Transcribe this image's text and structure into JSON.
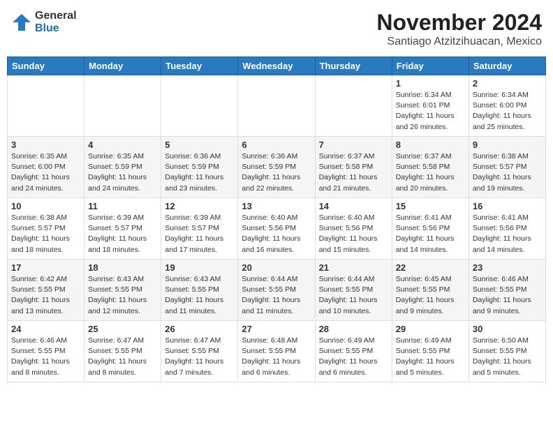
{
  "header": {
    "logo_general": "General",
    "logo_blue": "Blue",
    "month_title": "November 2024",
    "location": "Santiago Atzitzihuacan, Mexico"
  },
  "weekdays": [
    "Sunday",
    "Monday",
    "Tuesday",
    "Wednesday",
    "Thursday",
    "Friday",
    "Saturday"
  ],
  "weeks": [
    [
      {
        "day": "",
        "info": ""
      },
      {
        "day": "",
        "info": ""
      },
      {
        "day": "",
        "info": ""
      },
      {
        "day": "",
        "info": ""
      },
      {
        "day": "",
        "info": ""
      },
      {
        "day": "1",
        "info": "Sunrise: 6:34 AM\nSunset: 6:01 PM\nDaylight: 11 hours and 26 minutes."
      },
      {
        "day": "2",
        "info": "Sunrise: 6:34 AM\nSunset: 6:00 PM\nDaylight: 11 hours and 25 minutes."
      }
    ],
    [
      {
        "day": "3",
        "info": "Sunrise: 6:35 AM\nSunset: 6:00 PM\nDaylight: 11 hours and 24 minutes."
      },
      {
        "day": "4",
        "info": "Sunrise: 6:35 AM\nSunset: 5:59 PM\nDaylight: 11 hours and 24 minutes."
      },
      {
        "day": "5",
        "info": "Sunrise: 6:36 AM\nSunset: 5:59 PM\nDaylight: 11 hours and 23 minutes."
      },
      {
        "day": "6",
        "info": "Sunrise: 6:36 AM\nSunset: 5:59 PM\nDaylight: 11 hours and 22 minutes."
      },
      {
        "day": "7",
        "info": "Sunrise: 6:37 AM\nSunset: 5:58 PM\nDaylight: 11 hours and 21 minutes."
      },
      {
        "day": "8",
        "info": "Sunrise: 6:37 AM\nSunset: 5:58 PM\nDaylight: 11 hours and 20 minutes."
      },
      {
        "day": "9",
        "info": "Sunrise: 6:38 AM\nSunset: 5:57 PM\nDaylight: 11 hours and 19 minutes."
      }
    ],
    [
      {
        "day": "10",
        "info": "Sunrise: 6:38 AM\nSunset: 5:57 PM\nDaylight: 11 hours and 18 minutes."
      },
      {
        "day": "11",
        "info": "Sunrise: 6:39 AM\nSunset: 5:57 PM\nDaylight: 11 hours and 18 minutes."
      },
      {
        "day": "12",
        "info": "Sunrise: 6:39 AM\nSunset: 5:57 PM\nDaylight: 11 hours and 17 minutes."
      },
      {
        "day": "13",
        "info": "Sunrise: 6:40 AM\nSunset: 5:56 PM\nDaylight: 11 hours and 16 minutes."
      },
      {
        "day": "14",
        "info": "Sunrise: 6:40 AM\nSunset: 5:56 PM\nDaylight: 11 hours and 15 minutes."
      },
      {
        "day": "15",
        "info": "Sunrise: 6:41 AM\nSunset: 5:56 PM\nDaylight: 11 hours and 14 minutes."
      },
      {
        "day": "16",
        "info": "Sunrise: 6:41 AM\nSunset: 5:56 PM\nDaylight: 11 hours and 14 minutes."
      }
    ],
    [
      {
        "day": "17",
        "info": "Sunrise: 6:42 AM\nSunset: 5:55 PM\nDaylight: 11 hours and 13 minutes."
      },
      {
        "day": "18",
        "info": "Sunrise: 6:43 AM\nSunset: 5:55 PM\nDaylight: 11 hours and 12 minutes."
      },
      {
        "day": "19",
        "info": "Sunrise: 6:43 AM\nSunset: 5:55 PM\nDaylight: 11 hours and 11 minutes."
      },
      {
        "day": "20",
        "info": "Sunrise: 6:44 AM\nSunset: 5:55 PM\nDaylight: 11 hours and 11 minutes."
      },
      {
        "day": "21",
        "info": "Sunrise: 6:44 AM\nSunset: 5:55 PM\nDaylight: 11 hours and 10 minutes."
      },
      {
        "day": "22",
        "info": "Sunrise: 6:45 AM\nSunset: 5:55 PM\nDaylight: 11 hours and 9 minutes."
      },
      {
        "day": "23",
        "info": "Sunrise: 6:46 AM\nSunset: 5:55 PM\nDaylight: 11 hours and 9 minutes."
      }
    ],
    [
      {
        "day": "24",
        "info": "Sunrise: 6:46 AM\nSunset: 5:55 PM\nDaylight: 11 hours and 8 minutes."
      },
      {
        "day": "25",
        "info": "Sunrise: 6:47 AM\nSunset: 5:55 PM\nDaylight: 11 hours and 8 minutes."
      },
      {
        "day": "26",
        "info": "Sunrise: 6:47 AM\nSunset: 5:55 PM\nDaylight: 11 hours and 7 minutes."
      },
      {
        "day": "27",
        "info": "Sunrise: 6:48 AM\nSunset: 5:55 PM\nDaylight: 11 hours and 6 minutes."
      },
      {
        "day": "28",
        "info": "Sunrise: 6:49 AM\nSunset: 5:55 PM\nDaylight: 11 hours and 6 minutes."
      },
      {
        "day": "29",
        "info": "Sunrise: 6:49 AM\nSunset: 5:55 PM\nDaylight: 11 hours and 5 minutes."
      },
      {
        "day": "30",
        "info": "Sunrise: 6:50 AM\nSunset: 5:55 PM\nDaylight: 11 hours and 5 minutes."
      }
    ]
  ]
}
